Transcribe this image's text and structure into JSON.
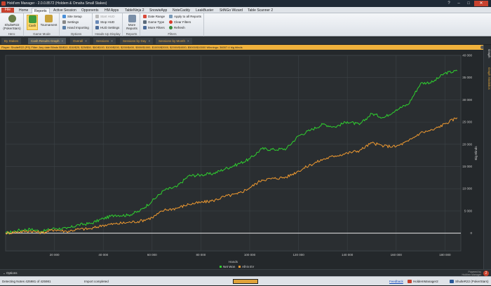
{
  "window": {
    "title": "Hold'em Manager - 2.0.0.8572 (Holdem & Omaha Small Stakes)",
    "file_label": "File"
  },
  "menu": [
    "Home",
    "Reports",
    "Active Session",
    "Opponents",
    "HM Apps",
    "TableNinja 2",
    "SnowieApp",
    "NoteCaddy",
    "LeakBuster",
    "SitNGo Wizard",
    "Table Scanner 2"
  ],
  "ribbon": {
    "hero": "ShulteR22\n(PokerStars)",
    "hero_line1": "ShulteR22",
    "hero_line2": "(PokerStars)",
    "hero_group": "Hero",
    "cash": "Cash",
    "tournament": "Tournament",
    "game_mode_group": "Game Mode",
    "site_setup": "Site Setup",
    "settings": "Settings",
    "hand_importing": "Hand Importing",
    "options_group": "Options",
    "start_hud": "Start HUD",
    "stop_hud": "Stop HUD",
    "hud_settings": "HUD Settings",
    "hud_group": "Heads-Up Display",
    "more_reports": "More Reports",
    "reports_group": "Reports",
    "date_range": "Date Range",
    "game_type": "Game Type",
    "more_filters": "More Filters",
    "apply_all": "Apply to all Reports",
    "clear_filters": "Clear Filters",
    "refresh": "Refresh",
    "filters_group": "Filters"
  },
  "view_tabs": [
    "By Stakes",
    "Cash Results Graph",
    "Overall",
    "Sessions",
    "Sessions by Day",
    "Sessions by Month"
  ],
  "active_tab": "Cash Results Graph",
  "filter_text": "Player: ShulteR22 (PS) Filter: Any date Blinds $5/$10, $10/$25, $25/$50, $50/$100, $100/$200, $200/$400, $500/$1000, $1000/$2000, $2000/$4000, $5000/$10000 Winnings: 36007.4 big blinds",
  "side_panel": {
    "graph": "Graph",
    "stats": "Graph Statistics"
  },
  "chart_data": {
    "type": "line",
    "xlabel": "Hands",
    "ylabel": "Big Blinds",
    "xlim": [
      0,
      186500
    ],
    "ylim": [
      -4000,
      40000
    ],
    "x_ticks": [
      "20 000",
      "40 000",
      "60 000",
      "80 000",
      "100 000",
      "120 000",
      "140 000",
      "160 000",
      "180 000"
    ],
    "x_tick_values": [
      20000,
      40000,
      60000,
      80000,
      100000,
      120000,
      140000,
      160000,
      180000
    ],
    "y_ticks": [
      "0",
      "5 000",
      "10 000",
      "15 000",
      "20 000",
      "25 000",
      "30 000",
      "35 000",
      "40 000"
    ],
    "y_tick_values": [
      0,
      5000,
      10000,
      15000,
      20000,
      25000,
      30000,
      35000,
      40000
    ],
    "grid": true,
    "legend_position": "bottom",
    "x": [
      0,
      5000,
      10000,
      15000,
      20000,
      25000,
      30000,
      35000,
      40000,
      45000,
      50000,
      55000,
      60000,
      65000,
      70000,
      75000,
      80000,
      85000,
      90000,
      95000,
      100000,
      105000,
      110000,
      115000,
      120000,
      125000,
      130000,
      135000,
      140000,
      145000,
      150000,
      155000,
      160000,
      165000,
      170000,
      175000,
      180000,
      185000
    ],
    "series": [
      {
        "name": "Net Won",
        "color": "#2fd02f",
        "values": [
          0,
          600,
          900,
          400,
          1100,
          1000,
          1900,
          2200,
          3300,
          4100,
          4000,
          5000,
          7200,
          9700,
          10400,
          12900,
          13100,
          13400,
          14500,
          15500,
          16700,
          19000,
          18800,
          19000,
          21900,
          23200,
          24500,
          23900,
          25100,
          24400,
          26900,
          26000,
          27800,
          29000,
          33700,
          34000,
          36000,
          36500
        ]
      },
      {
        "name": "All-in EV",
        "color": "#f09a30",
        "values": [
          0,
          300,
          500,
          100,
          800,
          400,
          900,
          1000,
          1800,
          2100,
          2400,
          2700,
          3500,
          5200,
          5600,
          6500,
          6900,
          7300,
          8300,
          8800,
          10200,
          12000,
          12300,
          12600,
          14000,
          15400,
          16600,
          17400,
          18000,
          18600,
          20300,
          19600,
          19500,
          20700,
          22600,
          23200,
          24600,
          26000
        ]
      }
    ]
  },
  "options_label": "Options",
  "logo": {
    "line1": "Powered by",
    "line2": "Hold'em Manager"
  },
  "status": {
    "left": "Detecting Notes 425981 of 425981",
    "import": "Import completed",
    "progress": 1.0,
    "feedback": "Feedback",
    "task1": "HoldemManager2",
    "task2": "ShulteR22 (PokerStars)"
  }
}
